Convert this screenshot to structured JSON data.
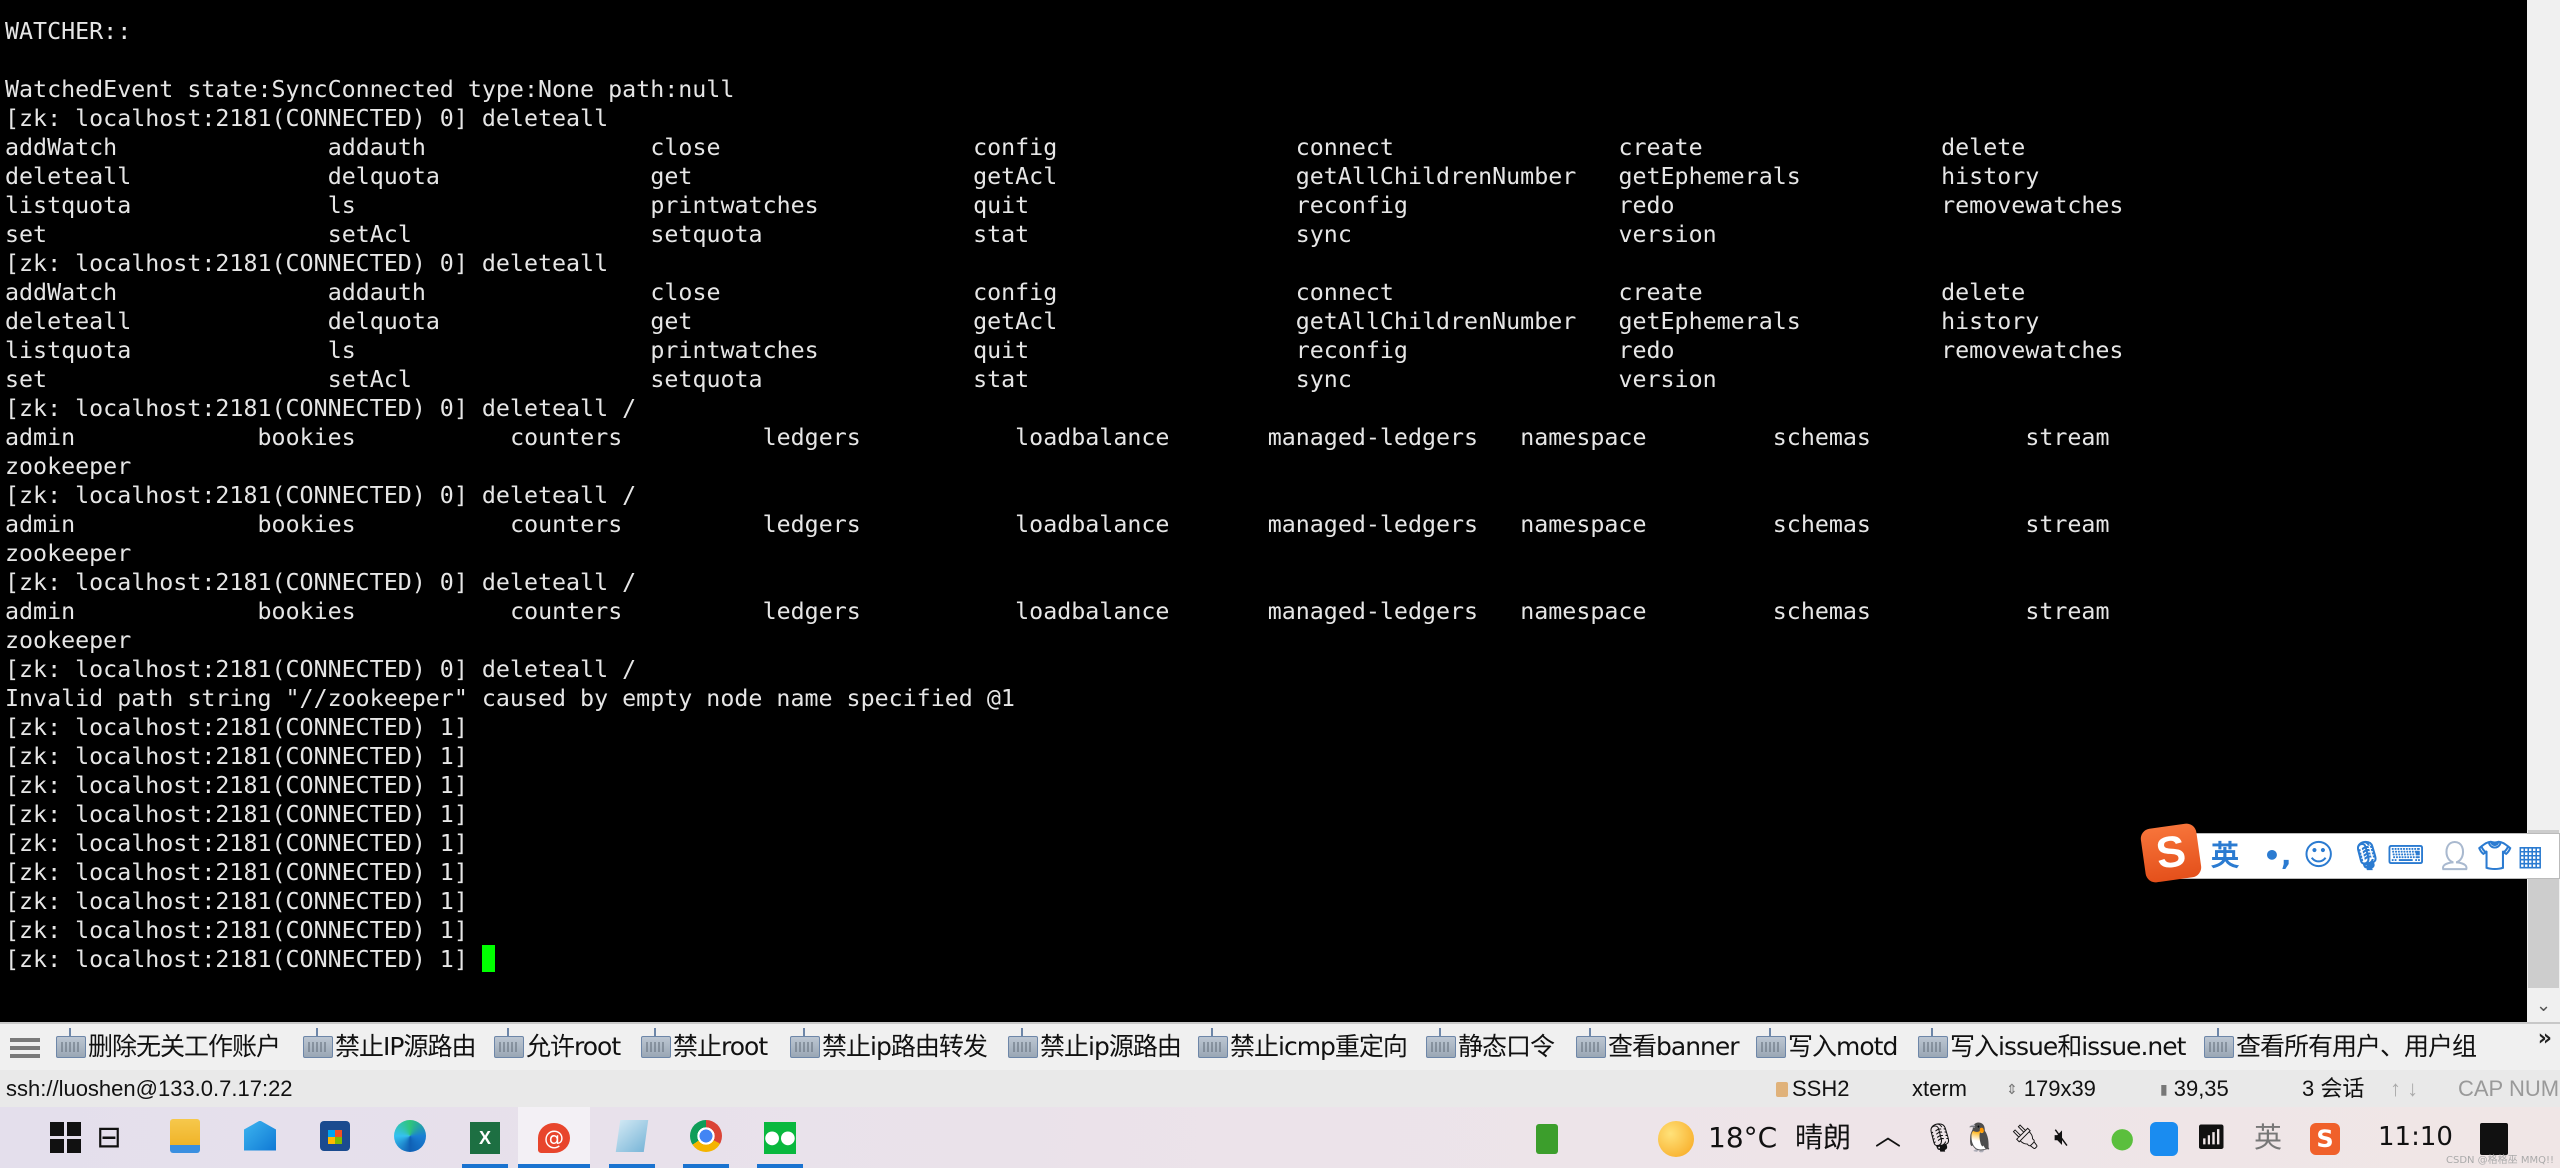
{
  "terminal": {
    "lines": [
      {
        "text": ""
      },
      {
        "text": "WATCHER::"
      },
      {
        "text": ""
      },
      {
        "text": "WatchedEvent state:SyncConnected type:None path:null"
      },
      {
        "text": "[zk: localhost:2181(CONNECTED) 0] deleteall"
      },
      {
        "cols": [
          "addWatch",
          "addauth",
          "close",
          "config",
          "connect",
          "create",
          "delete"
        ],
        "width": 23
      },
      {
        "cols": [
          "deleteall",
          "delquota",
          "get",
          "getAcl",
          "getAllChildrenNumber",
          "getEphemerals",
          "history"
        ],
        "width": 23
      },
      {
        "cols": [
          "listquota",
          "ls",
          "printwatches",
          "quit",
          "reconfig",
          "redo",
          "removewatches"
        ],
        "width": 23
      },
      {
        "cols": [
          "set",
          "setAcl",
          "setquota",
          "stat",
          "sync",
          "version"
        ],
        "width": 23
      },
      {
        "text": "[zk: localhost:2181(CONNECTED) 0] deleteall"
      },
      {
        "cols": [
          "addWatch",
          "addauth",
          "close",
          "config",
          "connect",
          "create",
          "delete"
        ],
        "width": 23
      },
      {
        "cols": [
          "deleteall",
          "delquota",
          "get",
          "getAcl",
          "getAllChildrenNumber",
          "getEphemerals",
          "history"
        ],
        "width": 23
      },
      {
        "cols": [
          "listquota",
          "ls",
          "printwatches",
          "quit",
          "reconfig",
          "redo",
          "removewatches"
        ],
        "width": 23
      },
      {
        "cols": [
          "set",
          "setAcl",
          "setquota",
          "stat",
          "sync",
          "version"
        ],
        "width": 23
      },
      {
        "text": "[zk: localhost:2181(CONNECTED) 0] deleteall /"
      },
      {
        "cols": [
          "admin",
          "bookies",
          "counters",
          "ledgers",
          "loadbalance",
          "managed-ledgers",
          "namespace",
          "schemas",
          "stream"
        ],
        "width": 18
      },
      {
        "text": "zookeeper"
      },
      {
        "text": "[zk: localhost:2181(CONNECTED) 0] deleteall /"
      },
      {
        "cols": [
          "admin",
          "bookies",
          "counters",
          "ledgers",
          "loadbalance",
          "managed-ledgers",
          "namespace",
          "schemas",
          "stream"
        ],
        "width": 18
      },
      {
        "text": "zookeeper"
      },
      {
        "text": "[zk: localhost:2181(CONNECTED) 0] deleteall /"
      },
      {
        "cols": [
          "admin",
          "bookies",
          "counters",
          "ledgers",
          "loadbalance",
          "managed-ledgers",
          "namespace",
          "schemas",
          "stream"
        ],
        "width": 18
      },
      {
        "text": "zookeeper"
      },
      {
        "text": "[zk: localhost:2181(CONNECTED) 0] deleteall /"
      },
      {
        "text": "Invalid path string \"//zookeeper\" caused by empty node name specified @1"
      },
      {
        "text": "[zk: localhost:2181(CONNECTED) 1]"
      },
      {
        "text": "[zk: localhost:2181(CONNECTED) 1]"
      },
      {
        "text": "[zk: localhost:2181(CONNECTED) 1]"
      },
      {
        "text": "[zk: localhost:2181(CONNECTED) 1]"
      },
      {
        "text": "[zk: localhost:2181(CONNECTED) 1]"
      },
      {
        "text": "[zk: localhost:2181(CONNECTED) 1]"
      },
      {
        "text": "[zk: localhost:2181(CONNECTED) 1]"
      },
      {
        "text": "[zk: localhost:2181(CONNECTED) 1]"
      },
      {
        "text": "[zk: localhost:2181(CONNECTED) 1]",
        "cursor": true
      }
    ],
    "cursor_color": "#00ff00"
  },
  "ime": {
    "logo": "S",
    "mode": "英",
    "punct": "•,",
    "items": [
      "emoji-icon",
      "mic-icon",
      "keyboard-icon",
      "user-icon",
      "skin-icon",
      "toolbox-icon"
    ]
  },
  "toolbar": {
    "items": [
      "删除无关工作账户",
      "禁止IP源路由",
      "允许root",
      "禁止root",
      "禁止ip路由转发",
      "禁止ip源路由",
      "禁止icmp重定向",
      "静态口令",
      "查看banner",
      "写入motd",
      "写入issue和issue.net",
      "查看所有用户、用户组"
    ],
    "more": "»"
  },
  "statusbar": {
    "connection": "ssh://luoshen@133.0.7.17:22",
    "protocol": "SSH2",
    "term": "xterm",
    "size": "179x39",
    "cursor_pos": "39,35",
    "sessions": "3 会话",
    "arrows": "↑ ↓",
    "locks": "CAP NUM"
  },
  "taskbar": {
    "apps": [
      {
        "name": "start",
        "active": false,
        "open": false
      },
      {
        "name": "task-view",
        "active": false,
        "open": false
      },
      {
        "name": "file-explorer",
        "active": false,
        "open": false
      },
      {
        "name": "mail",
        "active": false,
        "open": false
      },
      {
        "name": "store",
        "active": false,
        "open": false
      },
      {
        "name": "edge",
        "active": false,
        "open": false
      },
      {
        "name": "excel",
        "active": false,
        "open": true
      },
      {
        "name": "xshell",
        "active": true,
        "open": true
      },
      {
        "name": "notepad",
        "active": false,
        "open": true
      },
      {
        "name": "chrome",
        "active": false,
        "open": true
      },
      {
        "name": "wechat",
        "active": false,
        "open": true
      }
    ],
    "weather": {
      "temp": "18°C",
      "desc": "晴朗"
    },
    "tray_chevron": "^",
    "ime_lang": "英",
    "clock": "11:10",
    "watermark": "CSDN @格格巫 MMQ!!"
  }
}
